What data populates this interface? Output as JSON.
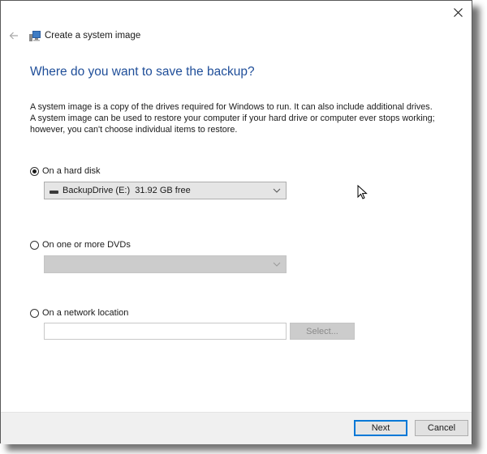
{
  "window": {
    "title": "Create a system image",
    "icons": {
      "back": "back-arrow-icon",
      "app": "system-image-icon",
      "close": "close-icon"
    }
  },
  "main": {
    "heading": "Where do you want to save the backup?",
    "description": "A system image is a copy of the drives required for Windows to run. It can also include additional drives. A system image can be used to restore your computer if your hard drive or computer ever stops working; however, you can't choose individual items to restore.",
    "options": [
      {
        "label": "On a hard disk",
        "selected": true,
        "control": {
          "type": "dropdown",
          "value": "BackupDrive (E:)  31.92 GB free",
          "enabled": true
        }
      },
      {
        "label": "On one or more DVDs",
        "selected": false,
        "control": {
          "type": "dropdown",
          "value": "",
          "enabled": false
        }
      },
      {
        "label": "On a network location",
        "selected": false,
        "control": {
          "type": "text",
          "value": "",
          "enabled": false,
          "button_label": "Select..."
        }
      }
    ]
  },
  "footer": {
    "next_label": "Next",
    "cancel_label": "Cancel"
  },
  "colors": {
    "heading": "#1f4e99",
    "focus_border": "#0078d7",
    "footer_bg": "#f0f0f0"
  }
}
